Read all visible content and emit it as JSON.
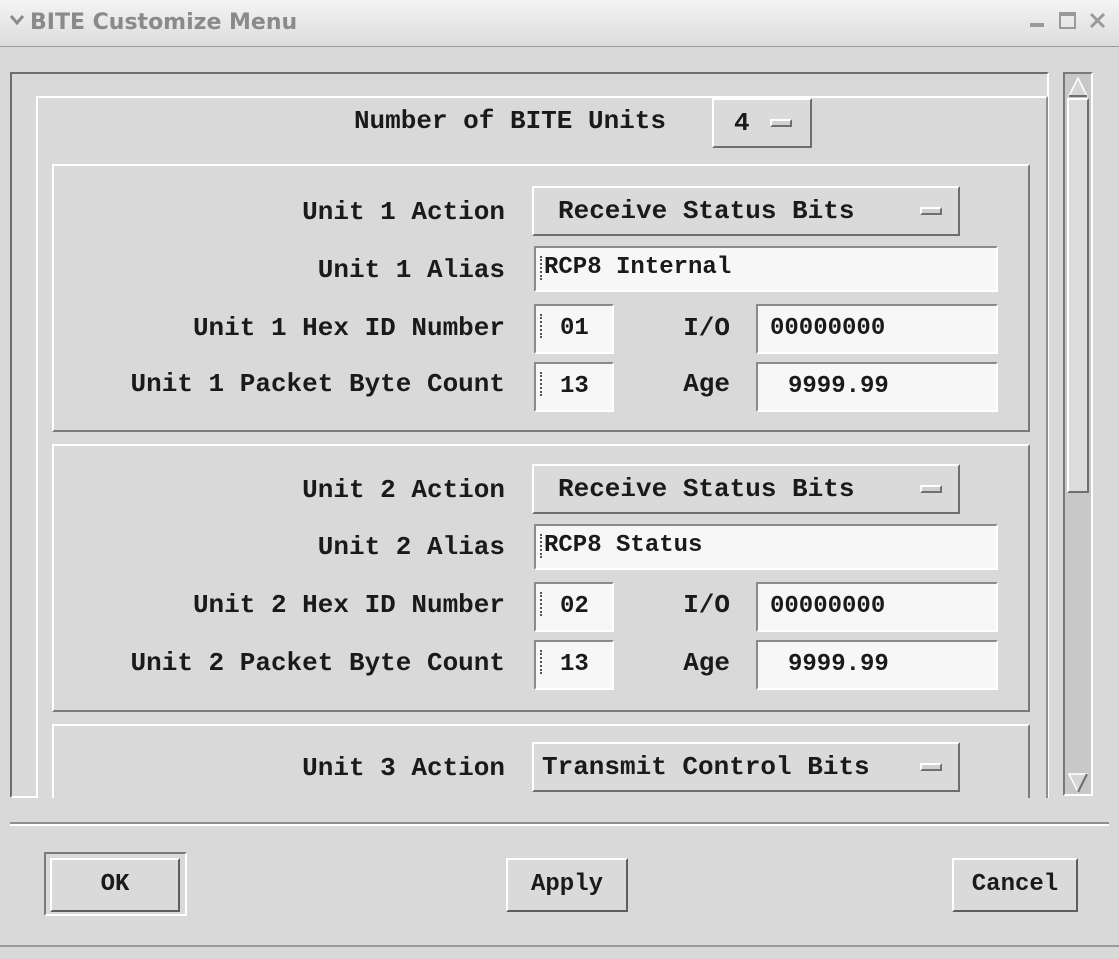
{
  "window": {
    "title": "BITE Customize Menu"
  },
  "header": {
    "units_label": "Number of BITE Units",
    "units_value": "4"
  },
  "units": [
    {
      "action_label": "Unit 1 Action",
      "action_value": "Receive Status Bits",
      "alias_label": "Unit 1 Alias",
      "alias_value": "RCP8 Internal",
      "hex_label": "Unit 1 Hex ID Number",
      "hex_value": "01",
      "io_label": "I/O",
      "io_value": "00000000",
      "count_label": "Unit 1 Packet Byte Count",
      "count_value": "13",
      "age_label": "Age",
      "age_value": "9999.99"
    },
    {
      "action_label": "Unit 2 Action",
      "action_value": "Receive Status Bits",
      "alias_label": "Unit 2 Alias",
      "alias_value": "RCP8 Status",
      "hex_label": "Unit 2 Hex ID Number",
      "hex_value": "02",
      "io_label": "I/O",
      "io_value": "00000000",
      "count_label": "Unit 2 Packet Byte Count",
      "count_value": "13",
      "age_label": "Age",
      "age_value": "9999.99"
    },
    {
      "action_label": "Unit 3 Action",
      "action_value": "Transmit Control Bits"
    }
  ],
  "buttons": {
    "ok": "OK",
    "apply": "Apply",
    "cancel": "Cancel"
  }
}
